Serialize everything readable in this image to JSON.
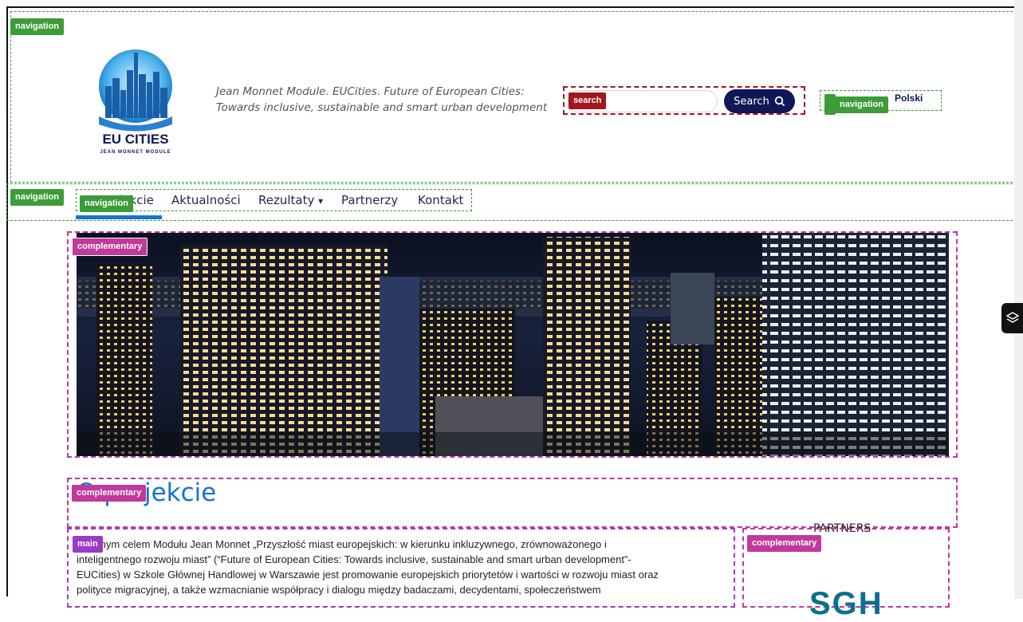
{
  "header": {
    "logo_text": "EU CITIES",
    "logo_subtext": "JEAN MONNET MODULE",
    "tagline": "Jean Monnet Module. EUCities. Future of European Cities: Towards inclusive, sustainable and smart urban development"
  },
  "search": {
    "label": "search",
    "placeholder": "",
    "button_label": "Search"
  },
  "language": {
    "label": "Polski"
  },
  "annotations": {
    "navigation": "navigation",
    "complementary": "complementary",
    "main": "main",
    "search": "search"
  },
  "menu": {
    "items": [
      {
        "label": "O projekcie"
      },
      {
        "label": "Aktualności"
      },
      {
        "label": "Rezultaty"
      },
      {
        "label": "Partnerzy"
      },
      {
        "label": "Kontakt"
      }
    ],
    "dropdown_symbol": "▾"
  },
  "page": {
    "title": "O projekcie",
    "partners_heading": "PARTNERS",
    "body_lines": [
      "Głównym celem Modułu Jean Monnet „Przyszłość miast europejskich: w kierunku inkluzywnego, zrównoważonego i",
      "inteligentnego rozwoju miast” (“Future of European Cities: Towards inclusive, sustainable and smart urban development”-",
      "EUCities) w Szkole Głównej Handlowej w Warszawie jest promowanie europejskich priorytetów i wartości w rozwoju miast oraz",
      "polityce migracyjnej, a także wzmacnianie współpracy i dialogu między badaczami, decydentami, społeczeństwem"
    ],
    "partner_logo_text": "SGH"
  },
  "colors": {
    "accent_blue": "#1473d8",
    "navy": "#0f1756",
    "nav_green": "#3e9b3a",
    "search_red": "#a3161d",
    "comp_pink": "#c0399b",
    "main_purple": "#9b3bc6"
  },
  "icons": {
    "search": "search-icon",
    "side_tool": "layers-icon"
  }
}
